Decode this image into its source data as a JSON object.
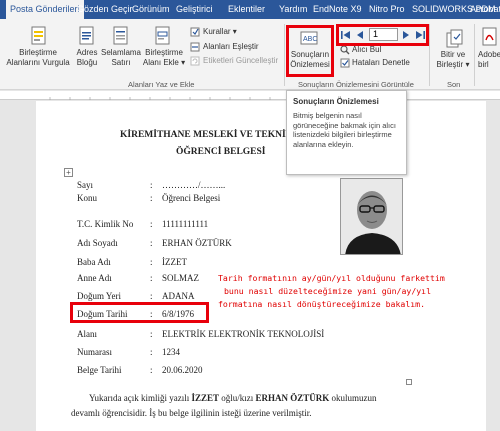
{
  "tabs": [
    {
      "label": "Posta Gönderileri",
      "active": true
    },
    {
      "label": "Gözden Geçir"
    },
    {
      "label": "Görünüm"
    },
    {
      "label": "Geliştirici"
    },
    {
      "label": "Eklentiler"
    },
    {
      "label": "Yardım"
    },
    {
      "label": "EndNote X9"
    },
    {
      "label": "Nitro Pro"
    },
    {
      "label": "SOLIDWORKS PDM"
    },
    {
      "label": "Acrobat"
    }
  ],
  "ribbon": {
    "birlestirme_alanlarini_vurgula": [
      "Birleştirme",
      "Alanlarını Vurgula"
    ],
    "adres_blogu": [
      "Adres",
      "Bloğu"
    ],
    "selamlama_satiri": [
      "Selamlama",
      "Satırı"
    ],
    "birlestirme_alani_ekle": [
      "Birleştirme",
      "Alanı Ekle ▾"
    ],
    "kurallar": "Kurallar ▾",
    "alanlari_eslestir": "Alanları Eşleştir",
    "etiketleri_guncellestir": "Etiketleri Güncelleştir",
    "group_alanlari": "Alanları Yaz ve Ekle",
    "sonuclarin_onizlemesi": [
      "Sonuçların",
      "Önizlemesi"
    ],
    "record_number": "1",
    "alici_bul": "Alıcı Bul",
    "hatalari_denetle": "Hataları Denetle",
    "group_sonuclar": "Sonuçların Önizlemesini Görüntüle",
    "bitir_ve_birlestir": [
      "Bitir ve",
      "Birleştir ▾"
    ],
    "group_son": "Son",
    "adobe_pdf": [
      "Adobe",
      "birl"
    ]
  },
  "tooltip": {
    "title": "Sonuçların Önizlemesi",
    "body": "Bitmiş belgenin nasıl görüneceğine bakmak için alıcı listenizdeki bilgileri birleştirme alanlarına ekleyin."
  },
  "document": {
    "title_line1": "KİREMİTHANE MESLEKİ VE TEKNİK A",
    "title_line2": "ÖĞRENCİ BELGESİ",
    "fields": [
      {
        "label": "Sayı",
        "value": "…………/……..."
      },
      {
        "label": "Konu",
        "value": "Öğrenci Belgesi"
      },
      {
        "label": "T.C. Kimlik No",
        "value": "11111111111"
      },
      {
        "label": "Adı Soyadı",
        "value": "ERHAN ÖZTÜRK"
      },
      {
        "label": "Baba Adı",
        "value": "İZZET"
      },
      {
        "label": "Anne Adı",
        "value": "SOLMAZ"
      },
      {
        "label": "Doğum Yeri",
        "value": "ADANA"
      },
      {
        "label": "Doğum Tarihi",
        "value": "6/8/1976"
      },
      {
        "label": "Alanı",
        "value": "ELEKTRİK ELEKTRONİK TEKNOLOJİSİ"
      },
      {
        "label": "Numarası",
        "value": "1234"
      },
      {
        "label": "Belge Tarihi",
        "value": "20.06.2020"
      }
    ],
    "separator": ":",
    "para_line1_a": "Yukarıda açık kimliği yazılı ",
    "para_line1_b": "İZZET",
    "para_line1_c": " oğlu/kızı ",
    "para_line1_d": "ERHAN ÖZTÜRK",
    "para_line1_e": " okulumuzun",
    "para_line2": "devamlı öğrencisidir. İş bu belge ilgilinin isteği üzerine verilmiştir.",
    "annotation": [
      "Tarih formatının ay/gün/yıl olduğunu farkettim",
      "bunu nasıl düzelteceğimize yani gün/ay/yıl",
      "formatına nasıl dönüştüreceğimize bakalım."
    ]
  },
  "colors": {
    "word_blue": "#2b579a",
    "highlight_red": "#e8000b"
  }
}
